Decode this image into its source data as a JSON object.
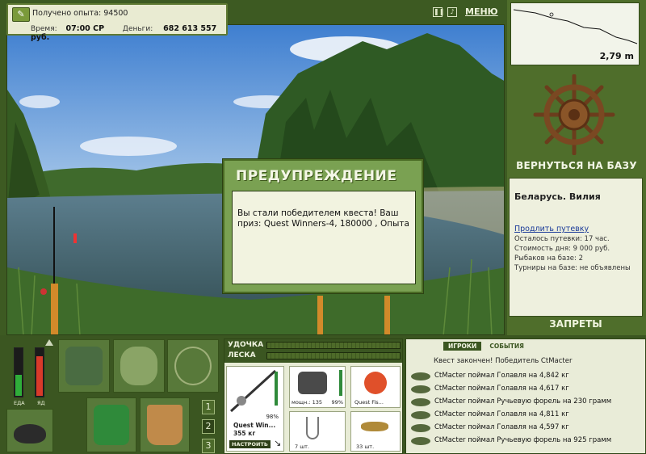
{
  "hud": {
    "experience": "Получено опыта: 94500",
    "time_label": "Время:",
    "time_value": "07:00 СР",
    "money_label": "Деньги:",
    "money_value": "682 613 557 руб."
  },
  "top": {
    "menu_label": "МЕНЮ",
    "pause_icon": "pause-icon",
    "sound_icon": "sound-icon"
  },
  "minimap": {
    "depth": "2,79 m"
  },
  "right": {
    "return_label": "ВЕРНУТЬСЯ НА БАЗУ",
    "base_name": "Беларусь. Вилия",
    "extend_link": "Продлить путевку",
    "info": [
      "Осталось путевки: 17 час.",
      "Стоимость дня: 9 000 руб.",
      "Рыбаков на базе: 2",
      "Турниры на базе: не объявлены"
    ],
    "bans_label": "ЗАПРЕТЫ"
  },
  "dialog": {
    "title": "ПРЕДУПРЕЖДЕНИЕ",
    "message": "Вы стали победителем квеста! Ваш приз: Quest Winners-4, 180000 , Опыта"
  },
  "bars": {
    "food_label": "ЕДА",
    "poison_label": "ЯД",
    "food_level": 0.45,
    "poison_level": 0.85
  },
  "inventory": {
    "pages": [
      "1",
      "2",
      "3"
    ],
    "active_page": "2"
  },
  "tackle": {
    "rod_label": "УДОЧКА",
    "line_label": "ЛЕСКА",
    "rod_name": "Quest Win...",
    "rod_weight": "355 кг",
    "rod_percent": "98%",
    "reel_power": "мощн.: 135",
    "reel_percent": "99%",
    "lure_name": "Quest Fis...",
    "hook_count": "7 шт.",
    "bait_count": "33 шт.",
    "setup_label": "НАСТРОИТЬ"
  },
  "events": {
    "tabs": [
      "ИГРОКИ",
      "СОБЫТИЯ"
    ],
    "header": "Квест закончен! Победитель CtMacter",
    "items": [
      "CtMacter поймал Голавля на 4,842 кг",
      "CtMacter поймал Голавля на 4,617 кг",
      "CtMacter поймал Ручьевую форель на 230 грамм",
      "CtMacter поймал Голавля на 4,811 кг",
      "CtMacter поймал Голавля на 4,597 кг",
      "CtMacter поймал Ручьевую форель на 925 грамм"
    ]
  },
  "colors": {
    "panel_green": "#4f6e2b",
    "dark_green": "#3b5621",
    "dialog_green": "#7aa152",
    "food_bar": "#2fae3a",
    "poison_bar": "#d93a2a"
  }
}
